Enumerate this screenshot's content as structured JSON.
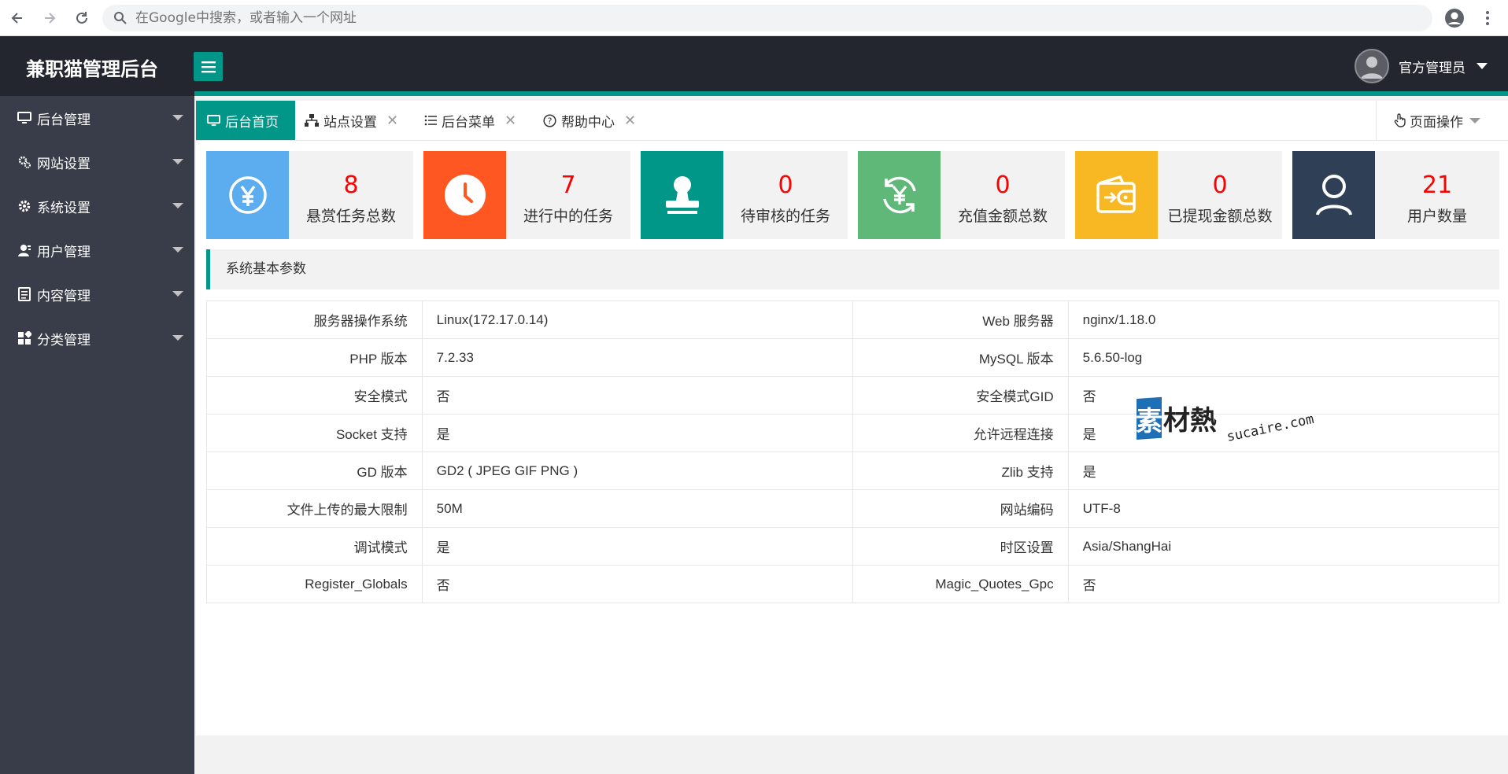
{
  "browser": {
    "omnibox_placeholder": "在Google中搜索，或者输入一个网址"
  },
  "header": {
    "app_title": "兼职猫管理后台",
    "user_name": "官方管理员"
  },
  "sidebar": {
    "items": [
      {
        "label": "后台管理",
        "icon": "monitor-icon"
      },
      {
        "label": "网站设置",
        "icon": "gears-icon"
      },
      {
        "label": "系统设置",
        "icon": "gear-icon"
      },
      {
        "label": "用户管理",
        "icon": "user-icon"
      },
      {
        "label": "内容管理",
        "icon": "document-icon"
      },
      {
        "label": "分类管理",
        "icon": "grid-icon"
      }
    ]
  },
  "tabs": [
    {
      "label": "后台首页",
      "icon": "monitor-icon",
      "active": true
    },
    {
      "label": "站点设置",
      "icon": "sitemap-icon"
    },
    {
      "label": "后台菜单",
      "icon": "list-icon"
    },
    {
      "label": "帮助中心",
      "icon": "help-icon"
    }
  ],
  "page_ops": {
    "label": "页面操作"
  },
  "cards": [
    {
      "value": "8",
      "label": "悬赏任务总数",
      "color": "#5cadef",
      "icon": "yen-circle-icon"
    },
    {
      "value": "7",
      "label": "进行中的任务",
      "color": "#ff5722",
      "icon": "clock-icon"
    },
    {
      "value": "0",
      "label": "待审核的任务",
      "color": "#009688",
      "icon": "stamp-icon"
    },
    {
      "value": "0",
      "label": "充值金额总数",
      "color": "#5fb878",
      "icon": "yen-refresh-icon"
    },
    {
      "value": "0",
      "label": "已提现金额总数",
      "color": "#f7b824",
      "icon": "wallet-icon"
    },
    {
      "value": "21",
      "label": "用户数量",
      "color": "#2f4056",
      "icon": "person-icon"
    }
  ],
  "section": {
    "title": "系统基本参数"
  },
  "params": [
    [
      "服务器操作系统",
      "Linux(172.17.0.14)",
      "Web 服务器",
      "nginx/1.18.0"
    ],
    [
      "PHP 版本",
      "7.2.33",
      "MySQL 版本",
      "5.6.50-log"
    ],
    [
      "安全模式",
      "否",
      "安全模式GID",
      "否"
    ],
    [
      "Socket 支持",
      "是",
      "允许远程连接",
      "是"
    ],
    [
      "GD 版本",
      "GD2 ( JPEG GIF PNG )",
      "Zlib 支持",
      "是"
    ],
    [
      "文件上传的最大限制",
      "50M",
      "网站编码",
      "UTF-8"
    ],
    [
      "调试模式",
      "是",
      "时区设置",
      "Asia/ShangHai"
    ],
    [
      "Register_Globals",
      "否",
      "Magic_Quotes_Gpc",
      "否"
    ]
  ],
  "watermark": {
    "brand": "素材熱",
    "domain": "sucaire.com"
  }
}
